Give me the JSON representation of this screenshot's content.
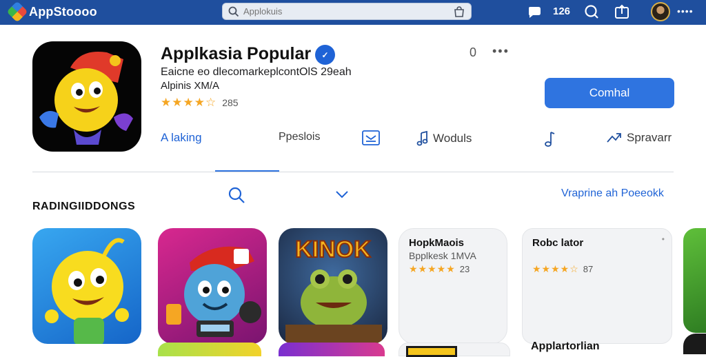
{
  "topbar": {
    "brand": "AppStoooo",
    "search_placeholder": "Applokuis",
    "notification_count": "126",
    "more": "••••"
  },
  "app": {
    "title": "Applkasia Popular",
    "verified_label": "✓",
    "subtitle": "Eaicne eo dlecomarkeplcontOlS 29eah",
    "developer": "Alpinis XM/A",
    "stars": "★★★★☆",
    "rating_count": "285",
    "header_count": "0",
    "install_label": "Comhal"
  },
  "tabs": [
    {
      "label": "A laking"
    },
    {
      "label": "Ppeslois"
    },
    {
      "label": ""
    },
    {
      "label": "Woduls"
    },
    {
      "label": ""
    },
    {
      "label": "Spravarr"
    }
  ],
  "section": {
    "title": "RADINGIIDDONGS",
    "link": "Vraprine ah Poeeokk"
  },
  "cards": [
    {
      "name": "HopkMaois",
      "sub": "Bpplkesk 1MVA",
      "stars": "★★★★★",
      "rating": "23"
    },
    {
      "name": "Robc lator",
      "sub": "",
      "stars": "★★★★☆",
      "rating": "87"
    }
  ],
  "game_card_title": "KINOK",
  "bottom_label": "Applartorlian",
  "colors": {
    "topbar": "#1f4f9e",
    "accent": "#2f74e0",
    "star": "#f5a623"
  }
}
